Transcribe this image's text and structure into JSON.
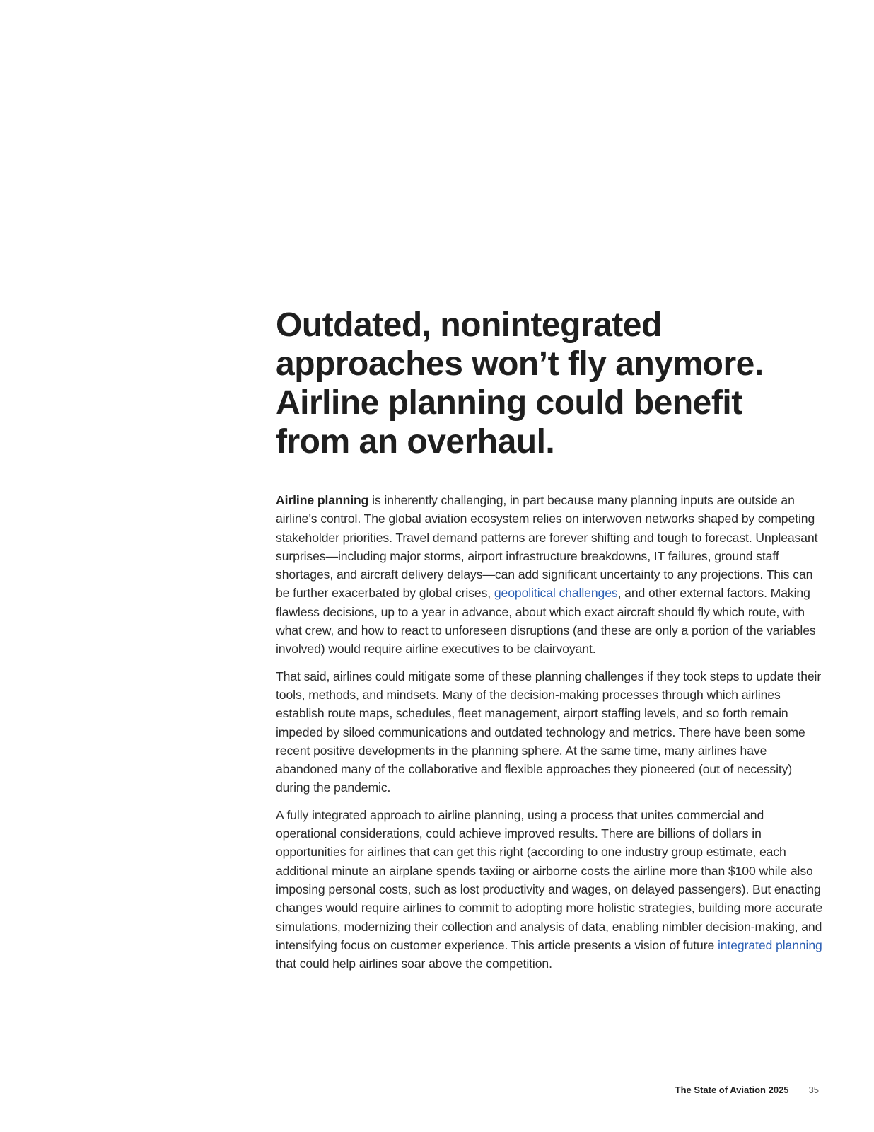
{
  "headline": {
    "lines": [
      "Outdated, nonintegrated",
      "approaches won’t fly anymore.",
      "Airline planning could benefit",
      "from an overhaul."
    ]
  },
  "paragraphs": {
    "p1": {
      "lead_bold": "Airline planning",
      "text_before_link": " is inherently challenging, in part because many planning inputs are outside an airline’s control. The global aviation ecosystem relies on interwoven networks shaped by competing stakeholder priorities. Travel demand patterns are forever shifting and tough to forecast. Unpleasant surprises—including major storms, airport infrastructure breakdowns, IT failures, ground staff shortages, and aircraft delivery delays—can add significant uncertainty to any projections. This can be further exacerbated by global crises, ",
      "link_text": "geopolitical challenges",
      "text_after_link": ", and other external factors. Making flawless decisions, up to a year in advance, about which exact aircraft should fly which route, with what crew, and how to react to unforeseen disruptions (and these are only a portion of the variables involved) would require airline executives to be clairvoyant."
    },
    "p2": {
      "text": "That said, airlines could mitigate some of these planning challenges if they took steps to update their tools, methods, and mindsets. Many of the decision-making processes through which airlines establish route maps, schedules, fleet management, airport staffing levels, and so forth remain impeded by siloed communications and outdated technology and metrics. There have been some recent positive developments in the planning sphere. At the same time, many airlines have abandoned many of the collaborative and flexible approaches they pioneered (out of necessity) during the pandemic."
    },
    "p3": {
      "text_before_link": "A fully integrated approach to airline planning, using a process that unites commercial and operational considerations, could achieve improved results. There are billions of dollars in opportunities for airlines that can get this right (according to one industry group estimate, each additional minute an airplane spends taxiing or airborne costs the airline more than $100 while also imposing personal costs, such as lost productivity and wages, on delayed passengers). But enacting changes would require airlines to commit to adopting more holistic strategies, building more accurate simulations, modernizing their collection and analysis of data, enabling nimbler decision-making, and intensifying focus on customer experience. This article presents a vision of future ",
      "link_text": "integrated planning",
      "text_after_link": " that could help airlines soar above the competition."
    }
  },
  "footer": {
    "publication": "The State of Aviation 2025",
    "page_number": "35"
  },
  "colors": {
    "text": "#1f1f1f",
    "link": "#2c5fb3",
    "background": "#ffffff"
  }
}
